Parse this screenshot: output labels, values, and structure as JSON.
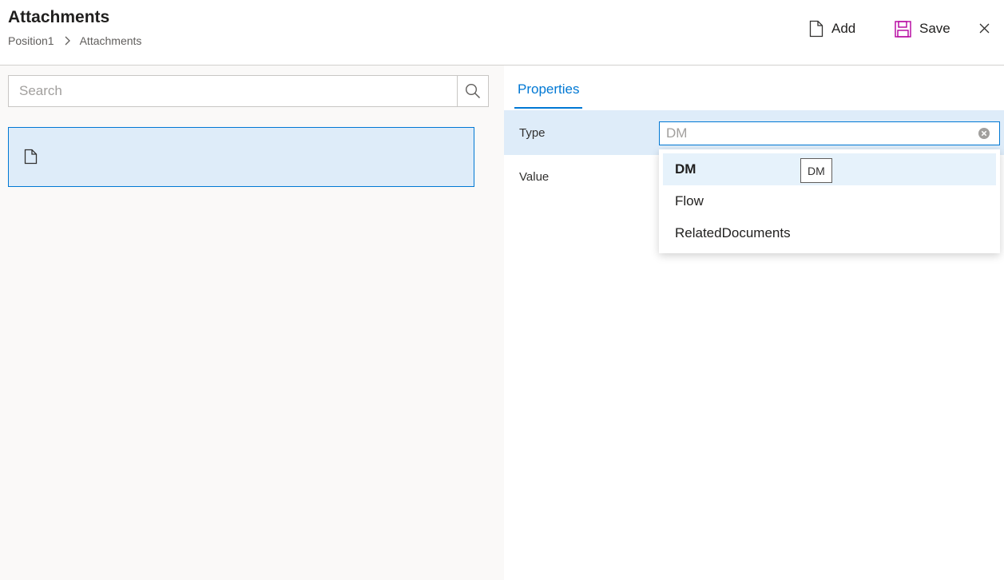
{
  "header": {
    "title": "Attachments",
    "breadcrumb": [
      "Position1",
      "Attachments"
    ],
    "commands": {
      "add_label": "Add",
      "save_label": "Save"
    }
  },
  "left_pane": {
    "search": {
      "placeholder": "Search",
      "value": ""
    },
    "items": [
      {
        "icon": "document-icon",
        "selected": true
      }
    ]
  },
  "right_pane": {
    "tab_label": "Properties",
    "fields": {
      "type_label": "Type",
      "value_label": "Value"
    },
    "type_combo": {
      "value": "",
      "placeholder": "DM",
      "options": [
        "DM",
        "Flow",
        "RelatedDocuments"
      ],
      "selected_option": "DM",
      "tooltip": "DM"
    }
  },
  "colors": {
    "accent": "#0078d4",
    "selection_bg": "#deecf9",
    "save_icon": "#b4009e",
    "left_pane_bg": "#faf9f8"
  }
}
